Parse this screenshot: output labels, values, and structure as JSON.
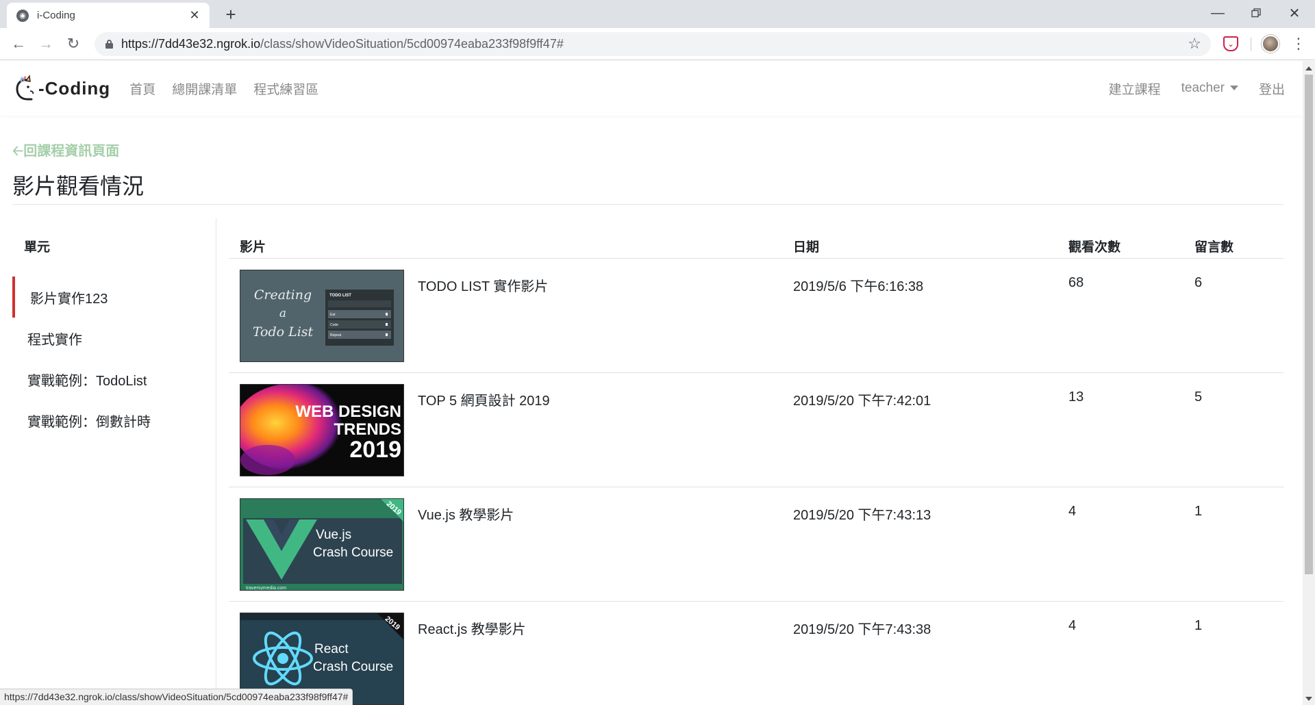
{
  "browser": {
    "tab_title": "i-Coding",
    "url_host": "https://7dd43e32.ngrok.io",
    "url_path": "/class/showVideoSituation/5cd00974eaba233f98f9ff47#"
  },
  "site": {
    "logo_text": "-Coding",
    "nav": [
      "首頁",
      "總開課清單",
      "程式練習區"
    ],
    "nav_right": {
      "create_course": "建立課程",
      "user": "teacher",
      "logout": "登出"
    }
  },
  "page": {
    "back_link": "回課程資訊頁面",
    "title": "影片觀看情況"
  },
  "sidebar": {
    "header": "單元",
    "items": [
      {
        "label": "影片實作123",
        "active": true
      },
      {
        "label": "程式實作",
        "active": false
      },
      {
        "label": "實戰範例：TodoList",
        "active": false
      },
      {
        "label": "實戰範例：倒數計時",
        "active": false
      }
    ]
  },
  "table": {
    "headers": {
      "video": "影片",
      "date": "日期",
      "views": "觀看次數",
      "comments": "留言數"
    },
    "rows": [
      {
        "title": "TODO LIST 實作影片",
        "date": "2019/5/6 下午6:16:38",
        "views": "68",
        "comments": "6",
        "thumb": {
          "lines": [
            "Creating",
            "a",
            "Todo List"
          ],
          "panel_title": "TODO LIST",
          "items": [
            "Eat",
            "Code",
            "Repeat"
          ]
        }
      },
      {
        "title": "TOP 5 網頁設計 2019",
        "date": "2019/5/20 下午7:42:01",
        "views": "13",
        "comments": "5",
        "thumb": {
          "lines": [
            "WEB DESIGN",
            "TRENDS",
            "2019"
          ]
        }
      },
      {
        "title": "Vue.js 教學影片",
        "date": "2019/5/20 下午7:43:13",
        "views": "4",
        "comments": "1",
        "thumb": {
          "lines": [
            "Vue.js",
            "Crash Course"
          ],
          "ribbon": "2019",
          "footer": "traversymedia.com"
        }
      },
      {
        "title": "React.js 教學影片",
        "date": "2019/5/20 下午7:43:38",
        "views": "4",
        "comments": "1",
        "thumb": {
          "lines": [
            "React",
            "Crash Course"
          ],
          "ribbon": "2019"
        }
      }
    ]
  },
  "status_bar": "https://7dd43e32.ngrok.io/class/showVideoSituation/5cd00974eaba233f98f9ff47#",
  "colors": {
    "accent_red": "#d03030",
    "back_link": "#a4cfa9",
    "nav_text": "#8a8a8a"
  }
}
